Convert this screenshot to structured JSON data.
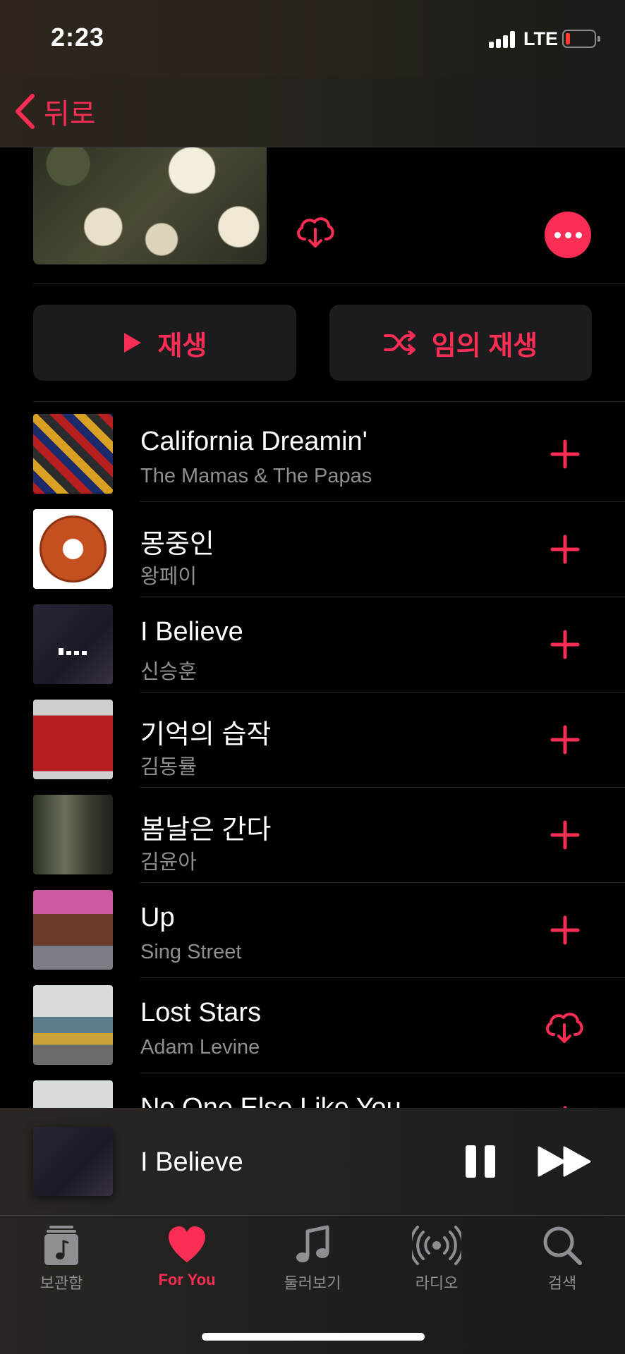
{
  "status_bar": {
    "time": "2:23",
    "network": "LTE",
    "battery_level": 0.1
  },
  "nav": {
    "back_label": "뒤로"
  },
  "actions": {
    "play_label": "재생",
    "shuffle_label": "임의 재생"
  },
  "tracks": [
    {
      "title": "California Dreamin'",
      "artist": "The Mamas & The Papas",
      "action": "add"
    },
    {
      "title": "몽중인",
      "artist": "왕페이",
      "action": "add"
    },
    {
      "title": "I Believe",
      "artist": "신승훈",
      "action": "add"
    },
    {
      "title": "기억의 습작",
      "artist": "김동률",
      "action": "add"
    },
    {
      "title": "봄날은 간다",
      "artist": "김윤아",
      "action": "add"
    },
    {
      "title": "Up",
      "artist": "Sing Street",
      "action": "add"
    },
    {
      "title": "Lost Stars",
      "artist": "Adam Levine",
      "action": "download"
    },
    {
      "title": "No One Else Like You",
      "artist": "",
      "action": "add"
    }
  ],
  "now_playing": {
    "title": "I Believe",
    "state": "playing"
  },
  "tabs": [
    {
      "label": "보관함",
      "icon": "library-icon",
      "active": false
    },
    {
      "label": "For You",
      "icon": "heart-icon",
      "active": true
    },
    {
      "label": "둘러보기",
      "icon": "music-note-icon",
      "active": false
    },
    {
      "label": "라디오",
      "icon": "radio-icon",
      "active": false
    },
    {
      "label": "검색",
      "icon": "search-icon",
      "active": false
    }
  ],
  "colors": {
    "accent": "#fa2d55",
    "background": "#000000",
    "secondary_text": "#8e8e93"
  }
}
